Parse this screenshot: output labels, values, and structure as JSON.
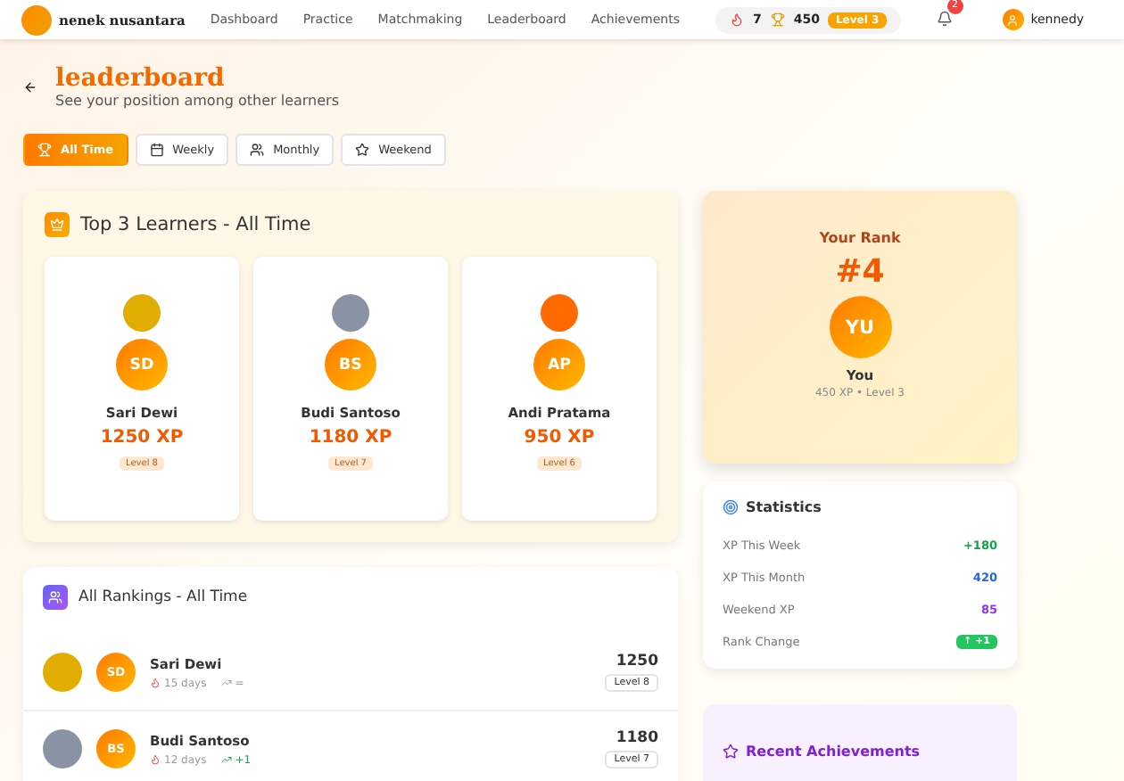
{
  "nav": {
    "brand": "nenek nusantara",
    "links": [
      "Dashboard",
      "Practice",
      "Matchmaking",
      "Leaderboard",
      "Achievements"
    ],
    "streak": "7",
    "xp": "450",
    "level": "Level 3",
    "notifications": "2",
    "user": "kennedy"
  },
  "header": {
    "title": "leaderboard",
    "subtitle": "See your position among other learners"
  },
  "filters": [
    {
      "label": "All Time",
      "selected": true
    },
    {
      "label": "Weekly",
      "selected": false
    },
    {
      "label": "Monthly",
      "selected": false
    },
    {
      "label": "Weekend",
      "selected": false
    }
  ],
  "top3": {
    "title": "Top 3 Learners - All Time",
    "learners": [
      {
        "initials": "SD",
        "name": "Sari Dewi",
        "xp": "1250 XP",
        "level": "Level 8",
        "color": "#e0ad00"
      },
      {
        "initials": "BS",
        "name": "Budi Santoso",
        "xp": "1180 XP",
        "level": "Level 7",
        "color": "#8a93a3"
      },
      {
        "initials": "AP",
        "name": "Andi Pratama",
        "xp": "950 XP",
        "level": "Level 6",
        "color": "#ff6a00"
      }
    ]
  },
  "rankings": {
    "title": "All Rankings - All Time",
    "rows": [
      {
        "initials": "SD",
        "name": "Sari Dewi",
        "streak": "15 days",
        "change": "=",
        "kind": "same",
        "xp": "1250",
        "level": "Level 8",
        "color": "#e0ad00"
      },
      {
        "initials": "BS",
        "name": "Budi Santoso",
        "streak": "12 days",
        "change": "+1",
        "kind": "up",
        "xp": "1180",
        "level": "Level 7",
        "color": "#8a93a3"
      }
    ]
  },
  "your_rank": {
    "title": "Your Rank",
    "rank": "#4",
    "initials": "YU",
    "name": "You",
    "detail": "450 XP • Level 3"
  },
  "statistics": {
    "title": "Statistics",
    "items": [
      {
        "label": "XP This Week",
        "value": "+180",
        "kind": "text",
        "color": "#16a34a"
      },
      {
        "label": "XP This Month",
        "value": "420",
        "kind": "text",
        "color": "#2563eb"
      },
      {
        "label": "Weekend XP",
        "value": "85",
        "kind": "text",
        "color": "#9333ea"
      },
      {
        "label": "Rank Change",
        "value": "↑ +1",
        "kind": "pill",
        "color": "#22c55e"
      }
    ]
  },
  "achievements": {
    "title": "Recent Achievements"
  }
}
